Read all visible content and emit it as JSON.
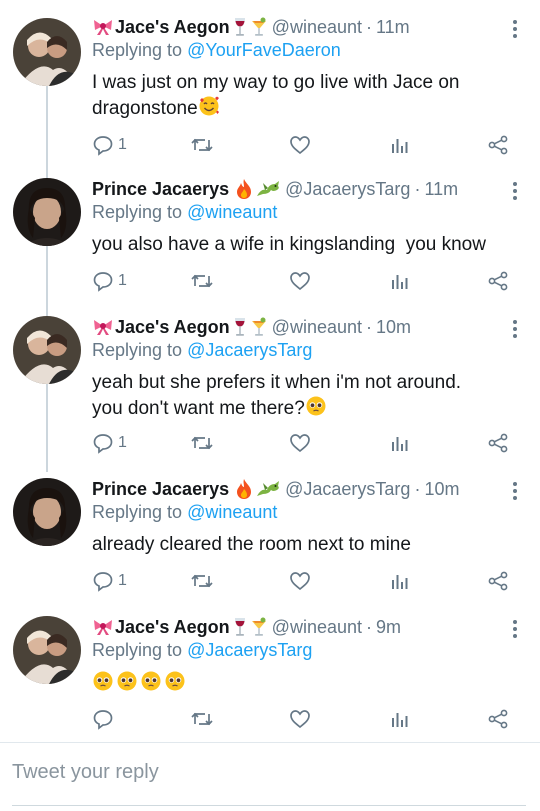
{
  "tweets": [
    {
      "name": "Jace's Aegon",
      "handle": "@wineaunt",
      "dot": "·",
      "time": "11m",
      "replying_prefix": "Replying to ",
      "replying_to": "@YourFaveDaeron",
      "text_line1": "I was just on my way to go live with Jace on",
      "text_line2": "dragonstone",
      "reply_count": "1",
      "emojis": [
        "ribbon-icon",
        "wine-glass-icon",
        "tropical-drink-icon"
      ]
    },
    {
      "name": "Prince Jacaerys",
      "handle": "@JacaerysTarg",
      "dot": "·",
      "time": "11m",
      "replying_prefix": "Replying to ",
      "replying_to": "@wineaunt",
      "text_line1": "you also have a wife in kingslanding  you know",
      "reply_count": "1",
      "emojis": [
        "fire-icon",
        "dragon-icon"
      ]
    },
    {
      "name": "Jace's Aegon",
      "handle": "@wineaunt",
      "dot": "·",
      "time": "10m",
      "replying_prefix": "Replying to ",
      "replying_to": "@JacaerysTarg",
      "text_line1": "yeah but she prefers it when i'm not around.",
      "text_line2": "you don't want me there?",
      "reply_count": "1",
      "emojis": [
        "ribbon-icon",
        "wine-glass-icon",
        "tropical-drink-icon"
      ]
    },
    {
      "name": "Prince Jacaerys",
      "handle": "@JacaerysTarg",
      "dot": "·",
      "time": "10m",
      "replying_prefix": "Replying to ",
      "replying_to": "@wineaunt",
      "text_line1": "already cleared the room next to mine",
      "reply_count": "1",
      "emojis": [
        "fire-icon",
        "dragon-icon"
      ]
    },
    {
      "name": "Jace's Aegon",
      "handle": "@wineaunt",
      "dot": "·",
      "time": "9m",
      "replying_prefix": "Replying to ",
      "replying_to": "@JacaerysTarg",
      "reply_count": "",
      "emojis": [
        "ribbon-icon",
        "wine-glass-icon",
        "tropical-drink-icon"
      ]
    }
  ],
  "composer": {
    "placeholder": "Tweet your reply"
  },
  "colors": {
    "link": "#1da1f2",
    "muted": "#657786",
    "text": "#14171a",
    "thread_line": "#ccd6dd"
  }
}
